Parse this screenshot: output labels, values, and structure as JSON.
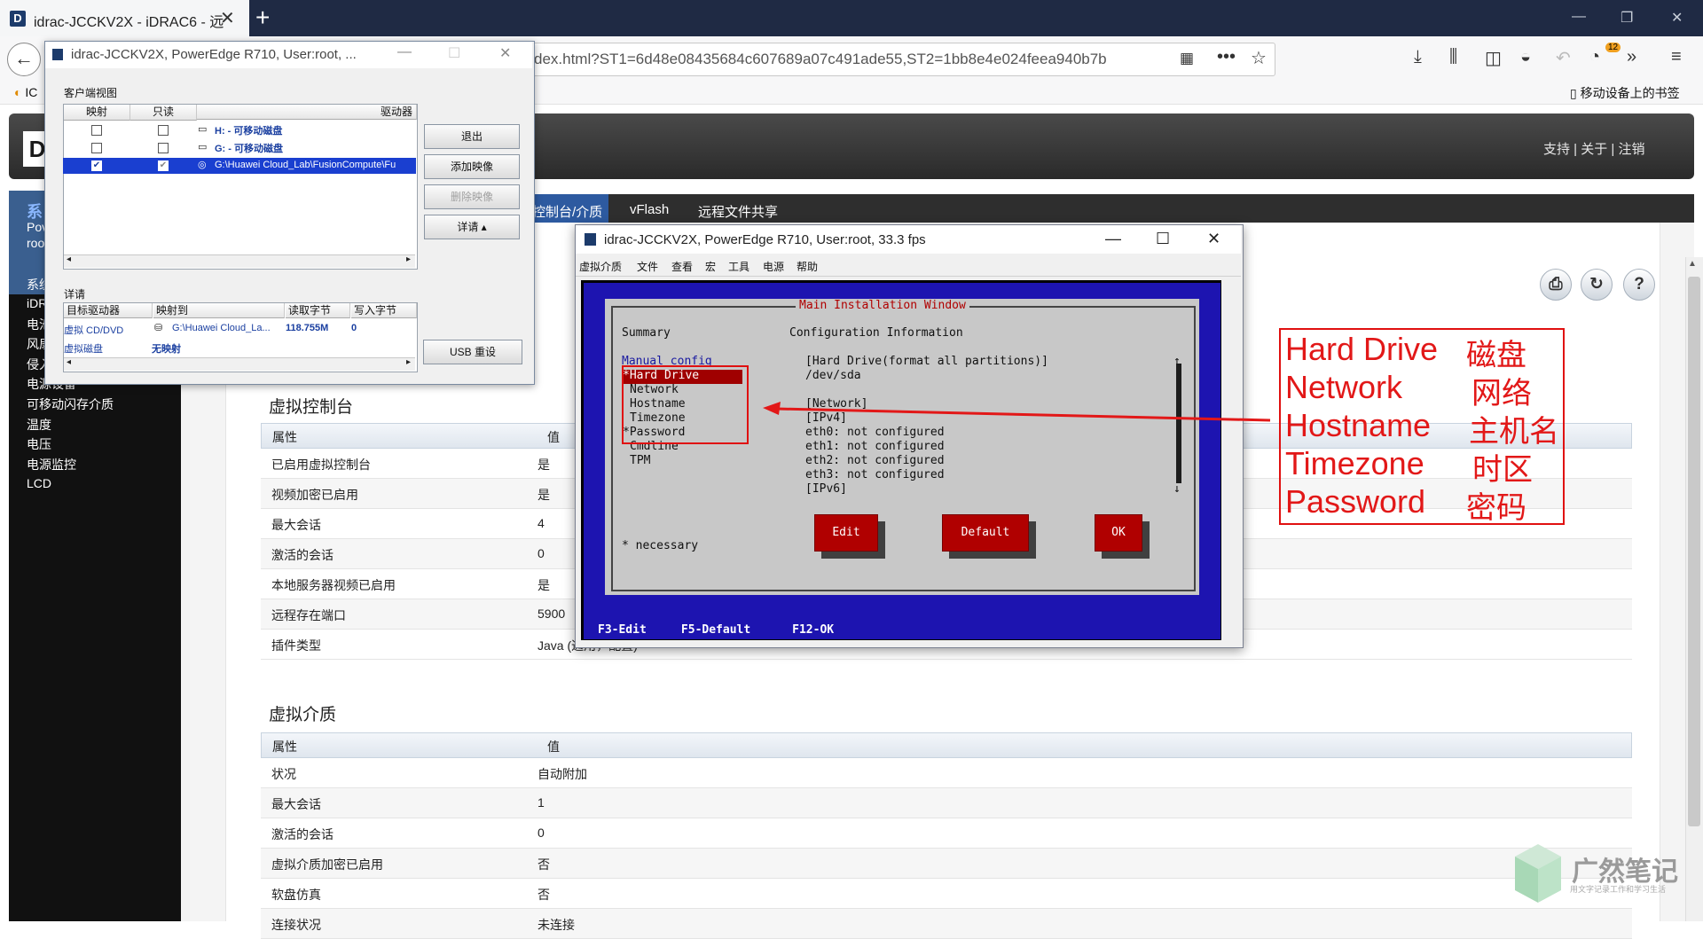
{
  "browser": {
    "tab_title": "idrac-JCCKV2X - iDRAC6 - 远",
    "url": "dex.html?ST1=6d48e08435684c607689a07c491ade55,ST2=1bb8e4e024feea940b7b",
    "bookmark_mobile": "移动设备上的书签",
    "bookmark_first": "IC",
    "badge_count": "12"
  },
  "idrac": {
    "header_links": "支持 | 关于 | 注销",
    "tabs": [
      "控制台/介质",
      "vFlash",
      "远程文件共享"
    ],
    "sidebar_title": "系",
    "sidebar_sub1": "Pov",
    "sidebar_sub2": "roo",
    "sidebar_items": [
      "系统",
      "iDR",
      "电池",
      "风扇",
      "侵入",
      "电源设备",
      "可移动闪存介质",
      "温度",
      "电压",
      "电源监控",
      "LCD"
    ],
    "console_section": {
      "title": "虚拟控制台",
      "col_property": "属性",
      "col_value": "值",
      "rows": [
        {
          "k": "已启用虚拟控制台",
          "v": "是"
        },
        {
          "k": "视频加密已启用",
          "v": "是"
        },
        {
          "k": "最大会话",
          "v": "4"
        },
        {
          "k": "激活的会话",
          "v": "0"
        },
        {
          "k": "本地服务器视频已启用",
          "v": "是"
        },
        {
          "k": "远程存在端口",
          "v": "5900"
        },
        {
          "k": "插件类型",
          "v": "Java (通用，配置)"
        }
      ]
    },
    "media_section": {
      "title": "虚拟介质",
      "col_property": "属性",
      "col_value": "值",
      "rows": [
        {
          "k": "状况",
          "v": "自动附加"
        },
        {
          "k": "最大会话",
          "v": "1"
        },
        {
          "k": "激活的会话",
          "v": "0"
        },
        {
          "k": "虚拟介质加密已启用",
          "v": "否"
        },
        {
          "k": "软盘仿真",
          "v": "否"
        },
        {
          "k": "连接状况",
          "v": "未连接"
        }
      ]
    }
  },
  "vm_dialog": {
    "title": "idrac-JCCKV2X, PowerEdge R710, User:root, ...",
    "client_view_label": "客户端视图",
    "cols": {
      "map": "映射",
      "readonly": "只读",
      "drive": "驱动器"
    },
    "drives": [
      {
        "label": "H: - 可移动磁盘"
      },
      {
        "label": "G: - 可移动磁盘"
      },
      {
        "label": "G:\\Huawei Cloud_Lab\\FusionCompute\\Fu"
      }
    ],
    "buttons": {
      "exit": "退出",
      "add_image": "添加映像",
      "remove_image": "删除映像",
      "details": "详请 ▴",
      "usb_reset": "USB 重设"
    },
    "details_label": "详请",
    "detail_cols": {
      "target": "目标驱动器",
      "mapped_to": "映射到",
      "read_bytes": "读取字节",
      "write_bytes": "写入字节"
    },
    "detail_rows": [
      {
        "target": "虚拟 CD/DVD",
        "mapped": "G:\\Huawei Cloud_La...",
        "read": "118.755M",
        "write": "0"
      },
      {
        "target": "虚拟磁盘",
        "mapped": "无映射",
        "read": "",
        "write": ""
      }
    ]
  },
  "console": {
    "title": "idrac-JCCKV2X, PowerEdge R710, User:root, 33.3 fps",
    "menu": [
      "虚拟介质",
      "文件",
      "查看",
      "宏",
      "工具",
      "电源",
      "帮助"
    ],
    "tui": {
      "window_title": "Main Installation Window",
      "summary": "Summary",
      "config_info": "Configuration Information",
      "manual_config": "Manual config",
      "items": [
        "*Hard Drive",
        "Network",
        "Hostname",
        "Timezone",
        "*Password",
        "Cmdline",
        "TPM"
      ],
      "info_lines": [
        "[Hard Drive(format all partitions)]",
        "/dev/sda",
        "",
        "[Network]",
        "[IPv4]",
        "eth0: not configured",
        "eth1: not configured",
        "eth2: not configured",
        "eth3: not configured",
        "[IPv6]"
      ],
      "necessary": "* necessary",
      "btn_edit": "Edit",
      "btn_default": "Default",
      "btn_ok": "OK",
      "fkeys": "F3-Edit     F5-Default      F12-OK"
    }
  },
  "annotation": {
    "lines": [
      {
        "en": "Hard Drive",
        "zh": "磁盘"
      },
      {
        "en": "Network",
        "zh": "网络"
      },
      {
        "en": "Hostname",
        "zh": "主机名"
      },
      {
        "en": "Timezone",
        "zh": "时区"
      },
      {
        "en": "Password",
        "zh": "密码"
      }
    ]
  },
  "watermark": {
    "title": "广然笔记",
    "sub": "用文字记录工作和学习生活"
  },
  "colors": {
    "accent_red": "#e21818",
    "tui_blue": "#1d14b0",
    "selection_blue": "#1a3fd0"
  }
}
